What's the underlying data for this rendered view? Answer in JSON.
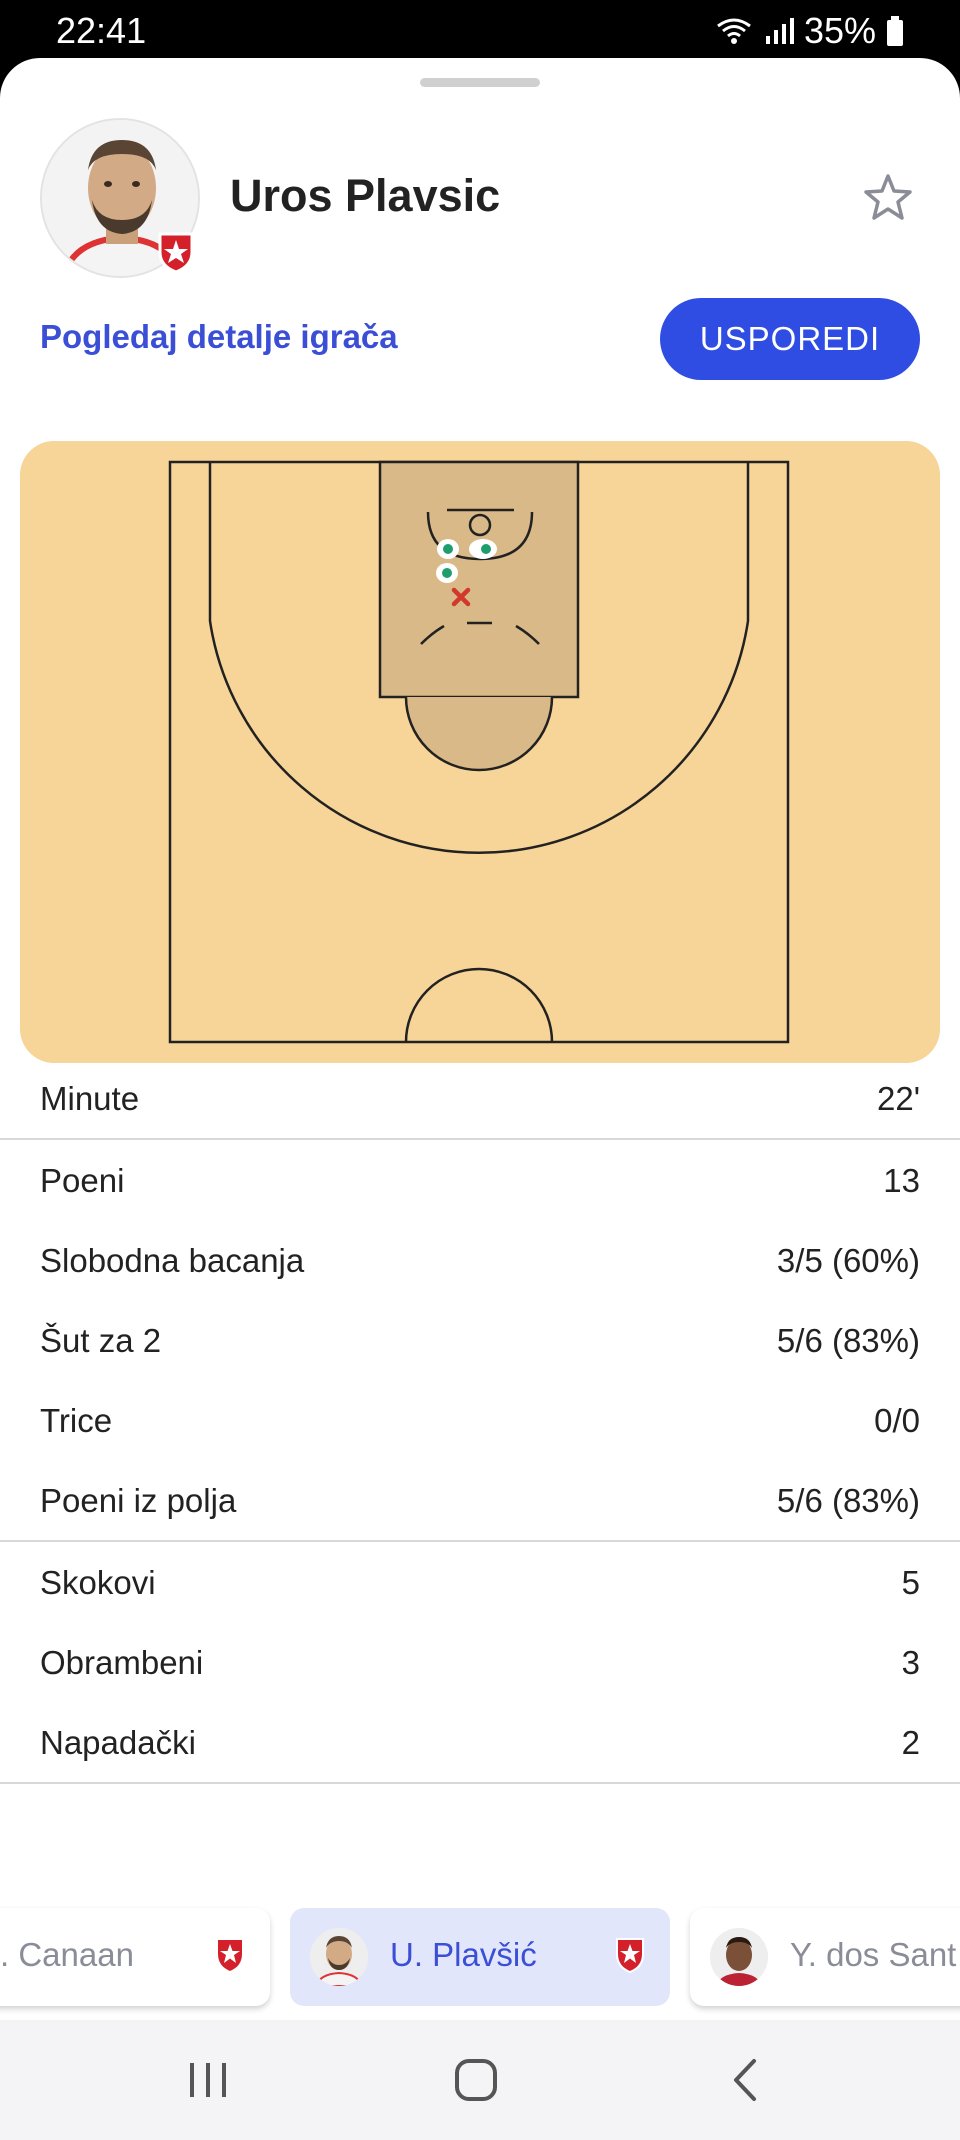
{
  "status_bar": {
    "time": "22:41",
    "battery": "35%"
  },
  "player": {
    "name": "Uros Plavsic"
  },
  "actions": {
    "details_link": "Pogledaj detalje igrača",
    "compare_button": "USPOREDI"
  },
  "stats": {
    "minutes": {
      "label": "Minute",
      "value": "22'"
    },
    "scoring": [
      {
        "label": "Poeni",
        "value": "13"
      },
      {
        "label": "Slobodna bacanja",
        "value": "3/5 (60%)"
      },
      {
        "label": "Šut za 2",
        "value": "5/6 (83%)"
      },
      {
        "label": "Trice",
        "value": "0/0"
      },
      {
        "label": "Poeni iz polja",
        "value": "5/6 (83%)"
      }
    ],
    "rebounds": [
      {
        "label": "Skokovi",
        "value": "5"
      },
      {
        "label": "Obrambeni",
        "value": "3"
      },
      {
        "label": "Napadački",
        "value": "2"
      }
    ]
  },
  "player_strip": [
    {
      "name": ". Canaan",
      "active": false
    },
    {
      "name": "U. Plavšić",
      "active": true
    },
    {
      "name": "Y. dos Sant",
      "active": false
    }
  ],
  "colors": {
    "accent": "#2f4de2",
    "link": "#3b4fd6",
    "court": "#f7d498",
    "paint": "#d9b987",
    "made_shot": "#1e9e6e",
    "missed_shot": "#d0392b"
  },
  "icons": {
    "favorite": "star-outline-icon",
    "club": "red-star-crest-icon",
    "nav_recents": "recents-icon",
    "nav_home": "home-icon",
    "nav_back": "back-icon"
  }
}
